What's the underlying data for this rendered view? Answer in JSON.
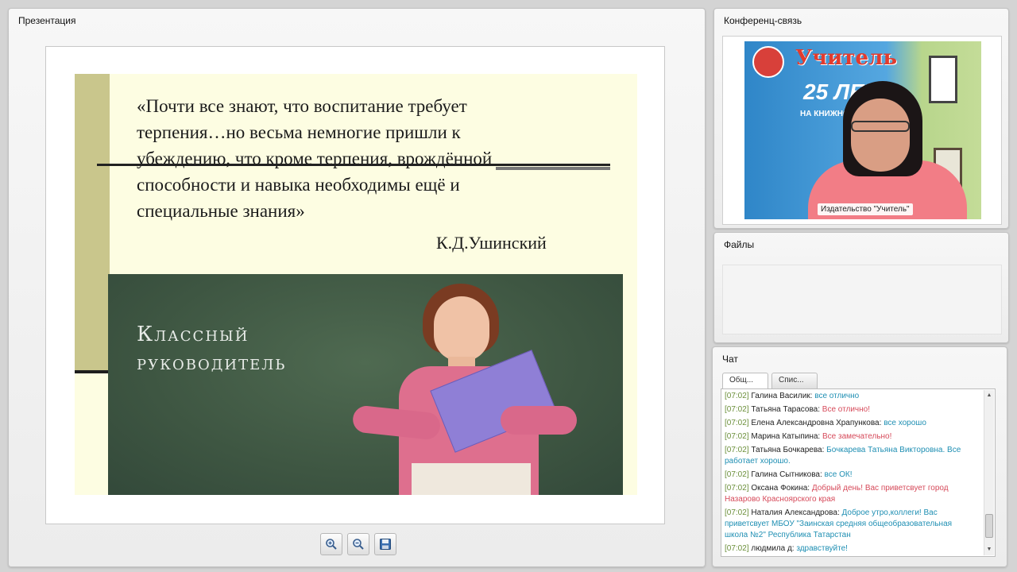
{
  "presentation": {
    "title": "Презентация",
    "slide": {
      "quote_lines": [
        "«Почти все знают, что воспитание требует",
        "терпения…но весьма немногие пришли к",
        "убеждению, что кроме терпения, врождённой",
        "способности и навыка необходимы ещё и",
        "специальные знания»"
      ],
      "author": "К.Д.Ушинский",
      "board_text_line1": "Классный",
      "board_text_line2": "руководитель"
    },
    "toolbar": {
      "zoom_in_icon": "zoom-in-icon",
      "zoom_out_icon": "zoom-out-icon",
      "save_icon": "save-icon"
    }
  },
  "conference": {
    "title": "Конференц-связь",
    "video_label": "Издательство \"Учитель\"",
    "banner_line1": "Учитель",
    "banner_line2": "25 ЛЕТ",
    "banner_line3": "НА КНИЖНОМ"
  },
  "files": {
    "title": "Файлы"
  },
  "chat": {
    "title": "Чат",
    "tabs": [
      {
        "label": "Общ..."
      },
      {
        "label": "Спис..."
      }
    ],
    "messages": [
      {
        "time": "[07:02]",
        "name": "Галина Василик:",
        "text": "все отлично",
        "color": "blue"
      },
      {
        "time": "[07:02]",
        "name": "Татьяна Тарасова:",
        "text": "Все отлично!",
        "color": "red"
      },
      {
        "time": "[07:02]",
        "name": "Елена Александровна Храпункова:",
        "text": "все хорошо",
        "color": "blue"
      },
      {
        "time": "[07:02]",
        "name": "Марина Катыпина:",
        "text": "Все замечательно!",
        "color": "red"
      },
      {
        "time": "[07:02]",
        "name": "Татьяна Бочкарева:",
        "text": "Бочкарева Татьяна Викторовна. Все работает хорошо.",
        "color": "blue"
      },
      {
        "time": "[07:02]",
        "name": "Галина Сытникова:",
        "text": "все ОК!",
        "color": "blue"
      },
      {
        "time": "[07:02]",
        "name": "Оксана Фокина:",
        "text": "Добрый день! Вас приветсвует город Назарово Красноярского края",
        "color": "red"
      },
      {
        "time": "[07:02]",
        "name": "Наталия Александрова:",
        "text": "Доброе утро,коллеги! Вас приветсвует МБОУ \"Заинская средняя общеобразовательная школа №2\" Республика Татарстан",
        "color": "blue"
      },
      {
        "time": "[07:02]",
        "name": "людмила д:",
        "text": "здравствуйте!",
        "color": "blue"
      }
    ]
  }
}
